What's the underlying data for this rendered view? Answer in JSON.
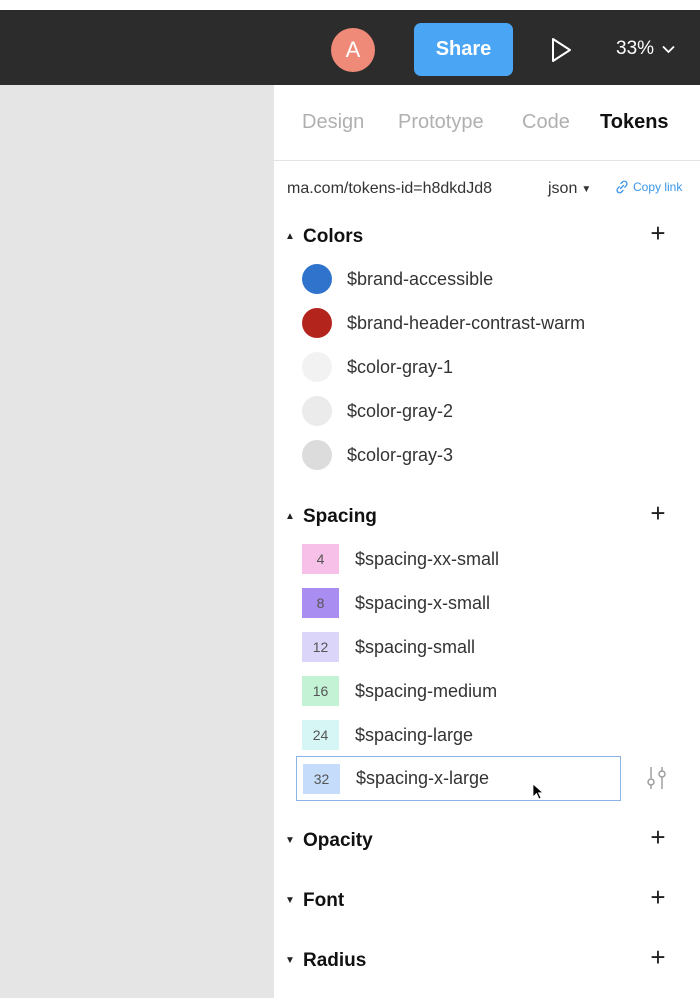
{
  "colors": {
    "topbar_bg": "#2c2c2c",
    "canvas_bg": "#e5e5e5",
    "avatar_bg": "#f08a78",
    "share_bg": "#4aa6f5",
    "link": "#3a95e8"
  },
  "toolbar": {
    "avatar_initial": "A",
    "share_label": "Share",
    "play_icon": "play-icon",
    "zoom_value": "33%",
    "zoom_chevron_icon": "chevron-down-icon"
  },
  "tabs": [
    {
      "label": "Design",
      "active": false
    },
    {
      "label": "Prototype",
      "active": false
    },
    {
      "label": "Code",
      "active": false
    },
    {
      "label": "Tokens",
      "active": true
    }
  ],
  "url_row": {
    "url": "ma.com/tokens-id=h8dkdJd8",
    "format": "json",
    "copy_label": "Copy link",
    "copy_icon": "link-icon"
  },
  "sections": {
    "colors": {
      "title": "Colors",
      "expanded": true,
      "items": [
        {
          "name": "$brand-accessible",
          "color": "#2f73cd"
        },
        {
          "name": "$brand-header-contrast-warm",
          "color": "#b3241c"
        },
        {
          "name": "$color-gray-1",
          "color": "#f2f2f2"
        },
        {
          "name": "$color-gray-2",
          "color": "#ebebeb"
        },
        {
          "name": "$color-gray-3",
          "color": "#dcdcdc"
        }
      ]
    },
    "spacing": {
      "title": "Spacing",
      "expanded": true,
      "items": [
        {
          "value": "4",
          "name": "$spacing-xx-small",
          "color": "#f7c0e8"
        },
        {
          "value": "8",
          "name": "$spacing-x-small",
          "color": "#a98df0"
        },
        {
          "value": "12",
          "name": "$spacing-small",
          "color": "#dcd5fa"
        },
        {
          "value": "16",
          "name": "$spacing-medium",
          "color": "#c3f2d5"
        },
        {
          "value": "24",
          "name": "$spacing-large",
          "color": "#d6f6f6"
        },
        {
          "value": "32",
          "name": "$spacing-x-large",
          "color": "#c6dcfb",
          "selected": true
        }
      ]
    },
    "opacity": {
      "title": "Opacity",
      "expanded": false
    },
    "font": {
      "title": "Font",
      "expanded": false
    },
    "radius": {
      "title": "Radius",
      "expanded": false
    }
  }
}
